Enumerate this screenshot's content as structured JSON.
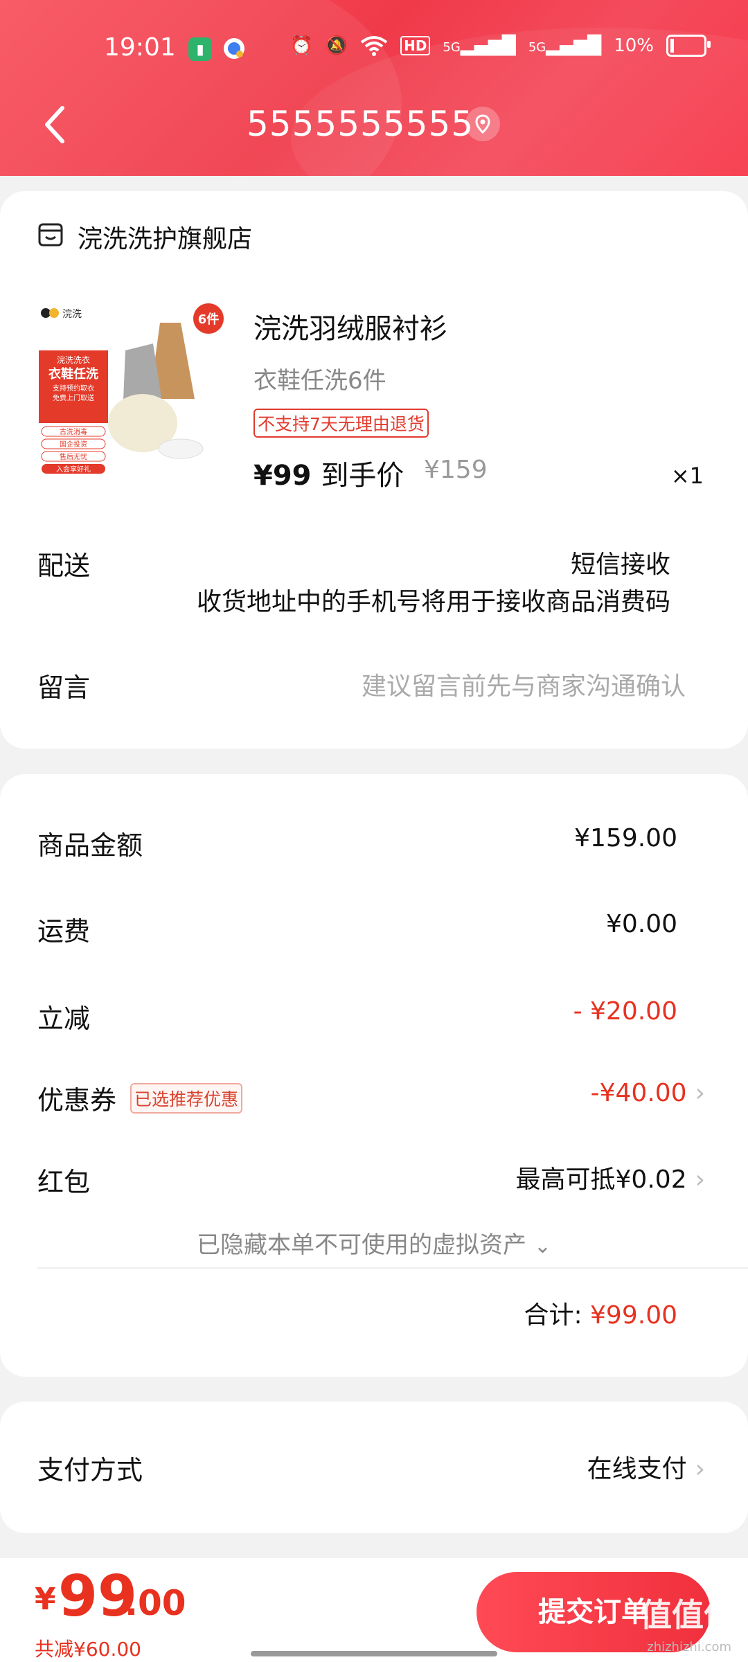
{
  "status_bar": {
    "time": "19:01",
    "hd": "HD",
    "net1": "5G",
    "net2": "5G",
    "battery": "10%"
  },
  "header": {
    "title": "5555555555"
  },
  "shop": {
    "name": "浣洗洗护旗舰店"
  },
  "product": {
    "name": "浣洗羽绒服衬衫",
    "subtitle": "衣鞋任洗6件",
    "tag": "不支持7天无理由退货",
    "price": "¥99",
    "price_label": "到手价",
    "original_price": "¥159",
    "quantity": "×1",
    "image": {
      "brand": "浣洗",
      "badge": "6件",
      "lines": [
        "浣洗洗衣",
        "衣鞋任洗",
        "支持预约取衣",
        "免费上门取送"
      ],
      "chips": [
        "古洗消毒",
        "国企投资",
        "售后无忧",
        "入会享好礼"
      ]
    }
  },
  "delivery": {
    "label": "配送",
    "value": "短信接收",
    "note": "收货地址中的手机号将用于接收商品消费码"
  },
  "message": {
    "label": "留言",
    "placeholder": "建议留言前先与商家沟通确认"
  },
  "summary": {
    "goods_amount_label": "商品金额",
    "goods_amount": "¥159.00",
    "shipping_label": "运费",
    "shipping": "¥0.00",
    "discount_label": "立减",
    "discount": "- ¥20.00",
    "coupon_label": "优惠券",
    "coupon_tag": "已选推荐优惠",
    "coupon": "-¥40.00",
    "redpacket_label": "红包",
    "redpacket": "最高可抵¥0.02",
    "hidden_assets": "已隐藏本单不可使用的虚拟资产",
    "total_label": "合计:",
    "total": "¥99.00"
  },
  "payment": {
    "label": "支付方式",
    "value": "在线支付"
  },
  "bottom_bar": {
    "currency": "¥",
    "price_int": "99",
    "price_dec": ".00",
    "saved": "共减¥60.00",
    "submit_label": "提交订单",
    "watermark": "值值值",
    "watermark_site": "zhizhizhi.com"
  },
  "colors": {
    "accent": "#f03a4a",
    "price_red": "#e8311f"
  }
}
